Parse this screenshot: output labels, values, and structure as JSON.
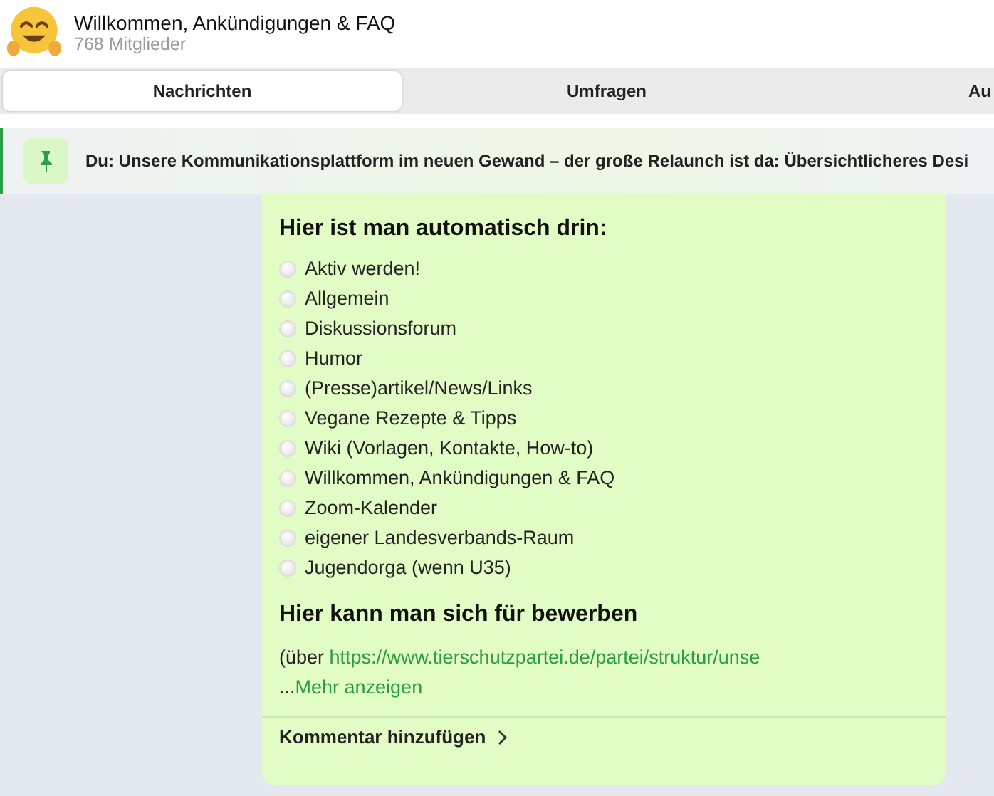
{
  "header": {
    "title": "Willkommen, Ankündigungen & FAQ",
    "subtitle": "768 Mitglieder"
  },
  "tabs": [
    {
      "label": "Nachrichten",
      "selected": true
    },
    {
      "label": "Umfragen",
      "selected": false
    },
    {
      "label": "Au",
      "selected": false
    }
  ],
  "pinned": {
    "text": "Du: Unsere Kommunikationsplattform im neuen Gewand – der große Relaunch ist da: Übersichtlicheres Desi"
  },
  "message": {
    "heading_1": "Hier ist man automatisch drin:",
    "items": [
      "Aktiv werden!",
      "Allgemein",
      "Diskussionsforum",
      "Humor",
      "(Presse)artikel/News/Links",
      "Vegane Rezepte & Tipps",
      "Wiki (Vorlagen, Kontakte, How-to)",
      "Willkommen, Ankündigungen & FAQ",
      "Zoom-Kalender",
      "eigener Landesverbands-Raum",
      "Jugendorga (wenn U35)"
    ],
    "heading_2": "Hier kann man sich für bewerben",
    "text_prefix": "(über ",
    "link": "https://www.tierschutzpartei.de/partei/struktur/unse",
    "ellipsis": "...",
    "more": "Mehr anzeigen",
    "comment": "Kommentar hinzufügen"
  }
}
